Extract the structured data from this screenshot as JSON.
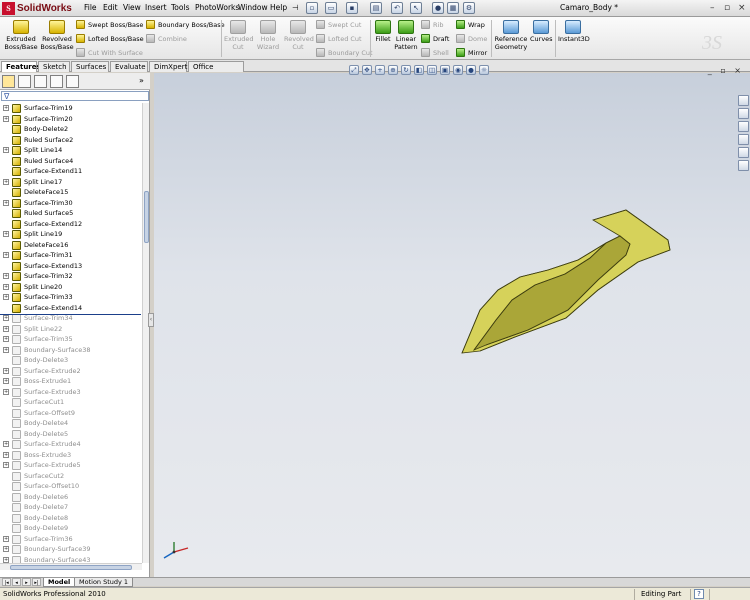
{
  "app": {
    "logo_text": "SolidWorks",
    "document_title": "Camaro_Body *",
    "menus": [
      "File",
      "Edit",
      "View",
      "Insert",
      "Tools",
      "PhotoWorks",
      "Window",
      "Help"
    ],
    "pin": "⊣"
  },
  "commands": {
    "extruded_boss": "Extruded Boss/Base",
    "revolved_boss": "Revolved Boss/Base",
    "swept_boss": "Swept Boss/Base",
    "lofted_boss": "Lofted Boss/Base",
    "boundary_boss": "Boundary Boss/Base",
    "combine": "Combine",
    "cut_with_surface": "Cut With Surface",
    "extruded_cut": "Extruded Cut",
    "hole_wizard": "Hole Wizard",
    "revolved_cut": "Revolved Cut",
    "swept_cut": "Swept Cut",
    "lofted_cut": "Lofted Cut",
    "boundary_cut": "Boundary Cut",
    "fillet": "Fillet",
    "linear_pattern": "Linear Pattern",
    "rib": "Rib",
    "draft": "Draft",
    "shell": "Shell",
    "wrap": "Wrap",
    "dome": "Dome",
    "mirror": "Mirror",
    "reference_geometry": "Reference Geometry",
    "curves": "Curves",
    "instant3d": "Instant3D"
  },
  "tabs": [
    "Features",
    "Sketch",
    "Surfaces",
    "Evaluate",
    "DimXpert",
    "Office Products"
  ],
  "feature_tree": [
    {
      "label": "Surface-Trim19",
      "expand": true,
      "suppressed": false
    },
    {
      "label": "Surface-Trim20",
      "expand": true,
      "suppressed": false
    },
    {
      "label": "Body-Delete2",
      "expand": false,
      "suppressed": false
    },
    {
      "label": "Ruled Surface2",
      "expand": false,
      "suppressed": false
    },
    {
      "label": "Split Line14",
      "expand": true,
      "suppressed": false
    },
    {
      "label": "Ruled Surface4",
      "expand": false,
      "suppressed": false
    },
    {
      "label": "Surface-Extend11",
      "expand": false,
      "suppressed": false
    },
    {
      "label": "Split Line17",
      "expand": true,
      "suppressed": false
    },
    {
      "label": "DeleteFace15",
      "expand": false,
      "suppressed": false
    },
    {
      "label": "Surface-Trim30",
      "expand": true,
      "suppressed": false
    },
    {
      "label": "Ruled Surface5",
      "expand": false,
      "suppressed": false
    },
    {
      "label": "Surface-Extend12",
      "expand": false,
      "suppressed": false
    },
    {
      "label": "Split Line19",
      "expand": true,
      "suppressed": false
    },
    {
      "label": "DeleteFace16",
      "expand": false,
      "suppressed": false
    },
    {
      "label": "Surface-Trim31",
      "expand": true,
      "suppressed": false
    },
    {
      "label": "Surface-Extend13",
      "expand": false,
      "suppressed": false
    },
    {
      "label": "Surface-Trim32",
      "expand": true,
      "suppressed": false
    },
    {
      "label": "Split Line20",
      "expand": true,
      "suppressed": false
    },
    {
      "label": "Surface-Trim33",
      "expand": true,
      "suppressed": false
    },
    {
      "label": "Surface-Extend14",
      "expand": false,
      "suppressed": false
    },
    {
      "label": "Surface-Trim34",
      "expand": true,
      "suppressed": true
    },
    {
      "label": "Split Line22",
      "expand": true,
      "suppressed": true
    },
    {
      "label": "Surface-Trim35",
      "expand": true,
      "suppressed": true
    },
    {
      "label": "Boundary-Surface38",
      "expand": true,
      "suppressed": true
    },
    {
      "label": "Body-Delete3",
      "expand": false,
      "suppressed": true
    },
    {
      "label": "Surface-Extrude2",
      "expand": true,
      "suppressed": true
    },
    {
      "label": "Boss-Extrude1",
      "expand": true,
      "suppressed": true
    },
    {
      "label": "Surface-Extrude3",
      "expand": true,
      "suppressed": true
    },
    {
      "label": "SurfaceCut1",
      "expand": false,
      "suppressed": true
    },
    {
      "label": "Surface-Offset9",
      "expand": false,
      "suppressed": true
    },
    {
      "label": "Body-Delete4",
      "expand": false,
      "suppressed": true
    },
    {
      "label": "Body-Delete5",
      "expand": false,
      "suppressed": true
    },
    {
      "label": "Surface-Extrude4",
      "expand": true,
      "suppressed": true
    },
    {
      "label": "Boss-Extrude3",
      "expand": true,
      "suppressed": true
    },
    {
      "label": "Surface-Extrude5",
      "expand": true,
      "suppressed": true
    },
    {
      "label": "SurfaceCut2",
      "expand": false,
      "suppressed": true
    },
    {
      "label": "Surface-Offset10",
      "expand": false,
      "suppressed": true
    },
    {
      "label": "Body-Delete6",
      "expand": false,
      "suppressed": true
    },
    {
      "label": "Body-Delete7",
      "expand": false,
      "suppressed": true
    },
    {
      "label": "Body-Delete8",
      "expand": false,
      "suppressed": true
    },
    {
      "label": "Body-Delete9",
      "expand": false,
      "suppressed": true
    },
    {
      "label": "Surface-Trim36",
      "expand": true,
      "suppressed": true
    },
    {
      "label": "Boundary-Surface39",
      "expand": true,
      "suppressed": true
    },
    {
      "label": "Boundary-Surface43",
      "expand": true,
      "suppressed": true
    }
  ],
  "bottom_tabs": [
    "Model",
    "Motion Study 1"
  ],
  "status": {
    "product": "SolidWorks Professional 2010",
    "mode": "Editing Part",
    "help": "?"
  },
  "colors": {
    "part_fill": "#d6d25a",
    "part_shade": "#aaa638",
    "part_edge": "#3f3f10",
    "background_top": "#c7cfdb"
  }
}
